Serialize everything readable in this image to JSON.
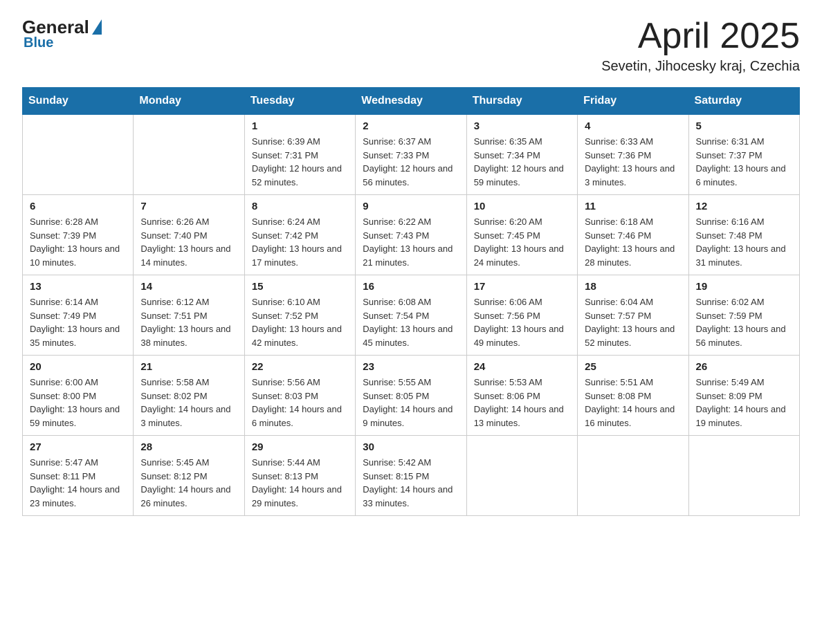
{
  "header": {
    "logo": {
      "general": "General",
      "blue": "Blue"
    },
    "title": "April 2025",
    "location": "Sevetin, Jihocesky kraj, Czechia"
  },
  "weekdays": [
    "Sunday",
    "Monday",
    "Tuesday",
    "Wednesday",
    "Thursday",
    "Friday",
    "Saturday"
  ],
  "weeks": [
    [
      {
        "day": "",
        "info": ""
      },
      {
        "day": "",
        "info": ""
      },
      {
        "day": "1",
        "info": "Sunrise: 6:39 AM\nSunset: 7:31 PM\nDaylight: 12 hours and 52 minutes."
      },
      {
        "day": "2",
        "info": "Sunrise: 6:37 AM\nSunset: 7:33 PM\nDaylight: 12 hours and 56 minutes."
      },
      {
        "day": "3",
        "info": "Sunrise: 6:35 AM\nSunset: 7:34 PM\nDaylight: 12 hours and 59 minutes."
      },
      {
        "day": "4",
        "info": "Sunrise: 6:33 AM\nSunset: 7:36 PM\nDaylight: 13 hours and 3 minutes."
      },
      {
        "day": "5",
        "info": "Sunrise: 6:31 AM\nSunset: 7:37 PM\nDaylight: 13 hours and 6 minutes."
      }
    ],
    [
      {
        "day": "6",
        "info": "Sunrise: 6:28 AM\nSunset: 7:39 PM\nDaylight: 13 hours and 10 minutes."
      },
      {
        "day": "7",
        "info": "Sunrise: 6:26 AM\nSunset: 7:40 PM\nDaylight: 13 hours and 14 minutes."
      },
      {
        "day": "8",
        "info": "Sunrise: 6:24 AM\nSunset: 7:42 PM\nDaylight: 13 hours and 17 minutes."
      },
      {
        "day": "9",
        "info": "Sunrise: 6:22 AM\nSunset: 7:43 PM\nDaylight: 13 hours and 21 minutes."
      },
      {
        "day": "10",
        "info": "Sunrise: 6:20 AM\nSunset: 7:45 PM\nDaylight: 13 hours and 24 minutes."
      },
      {
        "day": "11",
        "info": "Sunrise: 6:18 AM\nSunset: 7:46 PM\nDaylight: 13 hours and 28 minutes."
      },
      {
        "day": "12",
        "info": "Sunrise: 6:16 AM\nSunset: 7:48 PM\nDaylight: 13 hours and 31 minutes."
      }
    ],
    [
      {
        "day": "13",
        "info": "Sunrise: 6:14 AM\nSunset: 7:49 PM\nDaylight: 13 hours and 35 minutes."
      },
      {
        "day": "14",
        "info": "Sunrise: 6:12 AM\nSunset: 7:51 PM\nDaylight: 13 hours and 38 minutes."
      },
      {
        "day": "15",
        "info": "Sunrise: 6:10 AM\nSunset: 7:52 PM\nDaylight: 13 hours and 42 minutes."
      },
      {
        "day": "16",
        "info": "Sunrise: 6:08 AM\nSunset: 7:54 PM\nDaylight: 13 hours and 45 minutes."
      },
      {
        "day": "17",
        "info": "Sunrise: 6:06 AM\nSunset: 7:56 PM\nDaylight: 13 hours and 49 minutes."
      },
      {
        "day": "18",
        "info": "Sunrise: 6:04 AM\nSunset: 7:57 PM\nDaylight: 13 hours and 52 minutes."
      },
      {
        "day": "19",
        "info": "Sunrise: 6:02 AM\nSunset: 7:59 PM\nDaylight: 13 hours and 56 minutes."
      }
    ],
    [
      {
        "day": "20",
        "info": "Sunrise: 6:00 AM\nSunset: 8:00 PM\nDaylight: 13 hours and 59 minutes."
      },
      {
        "day": "21",
        "info": "Sunrise: 5:58 AM\nSunset: 8:02 PM\nDaylight: 14 hours and 3 minutes."
      },
      {
        "day": "22",
        "info": "Sunrise: 5:56 AM\nSunset: 8:03 PM\nDaylight: 14 hours and 6 minutes."
      },
      {
        "day": "23",
        "info": "Sunrise: 5:55 AM\nSunset: 8:05 PM\nDaylight: 14 hours and 9 minutes."
      },
      {
        "day": "24",
        "info": "Sunrise: 5:53 AM\nSunset: 8:06 PM\nDaylight: 14 hours and 13 minutes."
      },
      {
        "day": "25",
        "info": "Sunrise: 5:51 AM\nSunset: 8:08 PM\nDaylight: 14 hours and 16 minutes."
      },
      {
        "day": "26",
        "info": "Sunrise: 5:49 AM\nSunset: 8:09 PM\nDaylight: 14 hours and 19 minutes."
      }
    ],
    [
      {
        "day": "27",
        "info": "Sunrise: 5:47 AM\nSunset: 8:11 PM\nDaylight: 14 hours and 23 minutes."
      },
      {
        "day": "28",
        "info": "Sunrise: 5:45 AM\nSunset: 8:12 PM\nDaylight: 14 hours and 26 minutes."
      },
      {
        "day": "29",
        "info": "Sunrise: 5:44 AM\nSunset: 8:13 PM\nDaylight: 14 hours and 29 minutes."
      },
      {
        "day": "30",
        "info": "Sunrise: 5:42 AM\nSunset: 8:15 PM\nDaylight: 14 hours and 33 minutes."
      },
      {
        "day": "",
        "info": ""
      },
      {
        "day": "",
        "info": ""
      },
      {
        "day": "",
        "info": ""
      }
    ]
  ]
}
